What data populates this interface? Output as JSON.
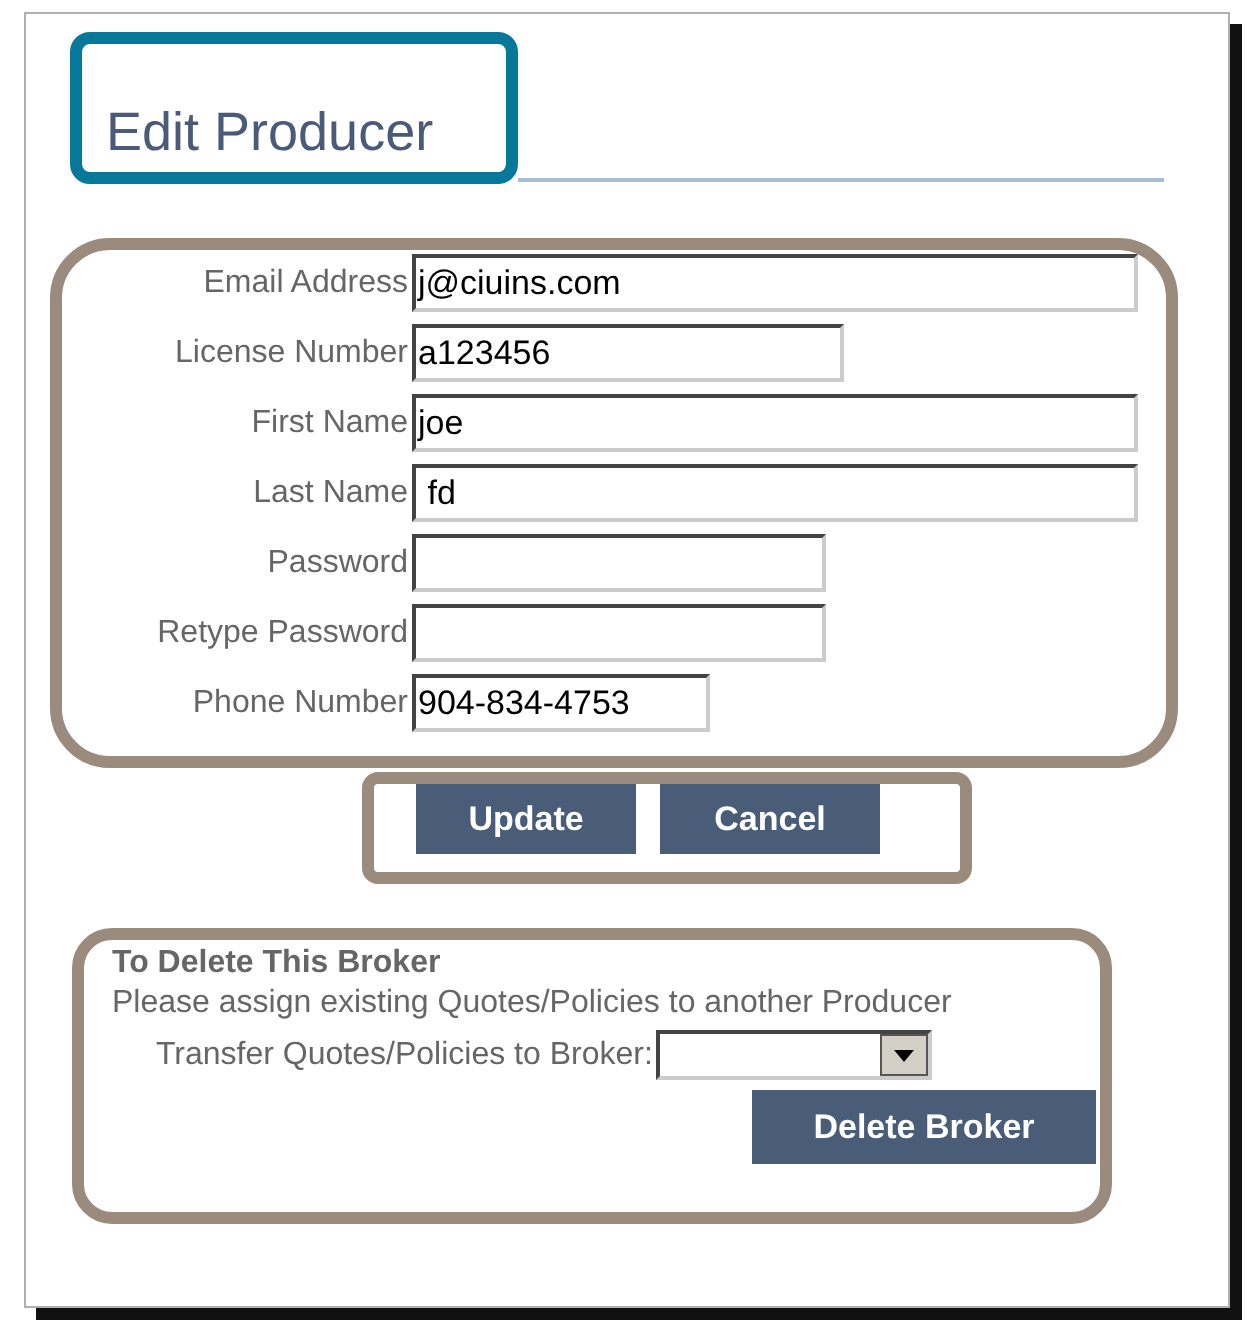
{
  "dialog": {
    "title": "Edit Producer"
  },
  "fields": [
    {
      "label": "Email Address",
      "value": "j@ciuins.com"
    },
    {
      "label": "License Number",
      "value": "a123456"
    },
    {
      "label": "First Name",
      "value": "joe"
    },
    {
      "label": "Last Name",
      "value": " fd"
    },
    {
      "label": "Password"
    },
    {
      "label": "Retype Password"
    },
    {
      "label": "Phone Number",
      "value": "904-834-4753"
    }
  ],
  "buttons": [
    "Update",
    "Cancel"
  ],
  "delete_section": {
    "heading": "To Delete This Broker",
    "note": "Please assign existing Quotes/Policies to another Producer",
    "transfer_label": "Transfer Quotes/Policies to Broker:",
    "button": "Delete Broker"
  }
}
